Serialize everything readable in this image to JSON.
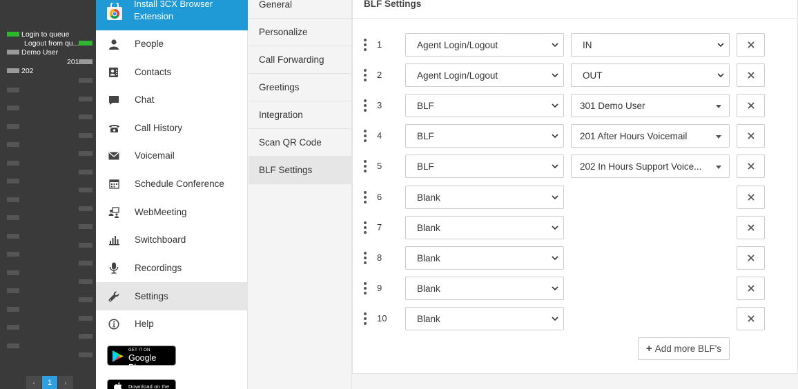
{
  "phone_panel": {
    "labels": [
      "Login to queue",
      "Logout from qu...",
      "Demo User",
      "201",
      "202"
    ],
    "pager": {
      "prev": "‹",
      "page": "1",
      "next": "›"
    }
  },
  "main_nav": {
    "banner": "Install 3CX Browser Extension",
    "items": [
      {
        "label": "People",
        "icon": "person-icon"
      },
      {
        "label": "Contacts",
        "icon": "contacts-icon"
      },
      {
        "label": "Chat",
        "icon": "chat-icon"
      },
      {
        "label": "Call History",
        "icon": "phone-icon"
      },
      {
        "label": "Voicemail",
        "icon": "envelope-icon"
      },
      {
        "label": "Schedule Conference",
        "icon": "calendar-icon"
      },
      {
        "label": "WebMeeting",
        "icon": "webmeeting-icon"
      },
      {
        "label": "Switchboard",
        "icon": "bar-chart-icon"
      },
      {
        "label": "Recordings",
        "icon": "microphone-icon"
      },
      {
        "label": "Settings",
        "icon": "wrench-icon"
      },
      {
        "label": "Help",
        "icon": "info-icon"
      }
    ],
    "google_play": {
      "small": "GET IT ON",
      "big": "Google Play"
    },
    "app_store": {
      "small": "Download on the"
    }
  },
  "settings_nav": {
    "items": [
      "General",
      "Personalize",
      "Call Forwarding",
      "Greetings",
      "Integration",
      "Scan QR Code",
      "BLF Settings"
    ],
    "active": "BLF Settings"
  },
  "blf": {
    "title": "BLF Settings",
    "rows": [
      {
        "num": "1",
        "type": "Agent Login/Logout",
        "value": "IN",
        "value_kind": "select"
      },
      {
        "num": "2",
        "type": "Agent Login/Logout",
        "value": "OUT",
        "value_kind": "select"
      },
      {
        "num": "3",
        "type": "BLF",
        "value": "301 Demo User",
        "value_kind": "combo"
      },
      {
        "num": "4",
        "type": "BLF",
        "value": "201 After Hours Voicemail",
        "value_kind": "combo"
      },
      {
        "num": "5",
        "type": "BLF",
        "value": "202 In Hours Support Voice...",
        "value_kind": "combo"
      },
      {
        "num": "6",
        "type": "Blank",
        "value": "",
        "value_kind": "none"
      },
      {
        "num": "7",
        "type": "Blank",
        "value": "",
        "value_kind": "none"
      },
      {
        "num": "8",
        "type": "Blank",
        "value": "",
        "value_kind": "none"
      },
      {
        "num": "9",
        "type": "Blank",
        "value": "",
        "value_kind": "none"
      },
      {
        "num": "10",
        "type": "Blank",
        "value": "",
        "value_kind": "none"
      }
    ],
    "remove_label": "×",
    "add_more": "Add more BLF's",
    "add_plus": "+"
  },
  "colors": {
    "accent": "#1f9ad6",
    "green_key": "#2fb52f",
    "active_nav": "#e6e6e6"
  }
}
